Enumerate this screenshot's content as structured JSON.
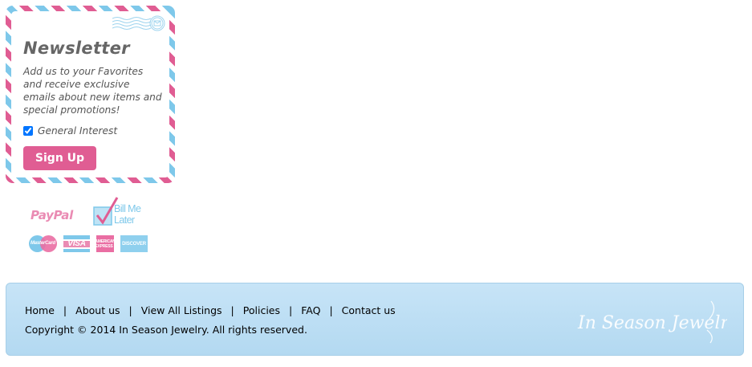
{
  "newsletter": {
    "title": "Newsletter",
    "description": "Add us to your Favorites and receive exclusive emails about new items and special promotions!",
    "checkbox_label": "General Interest",
    "checkbox_checked": true,
    "signup_label": "Sign Up"
  },
  "payments": {
    "paypal": "PayPal",
    "billme": [
      "Bill Me",
      "Later"
    ],
    "cards": {
      "mastercard": "MasterCard",
      "visa": "VISA",
      "amex": "AMERICAN EXPRESS",
      "discover": "DISCOVER"
    }
  },
  "footer": {
    "nav": [
      {
        "label": "Home"
      },
      {
        "label": "About us"
      },
      {
        "label": "View All Listings"
      },
      {
        "label": "Policies"
      },
      {
        "label": "FAQ"
      },
      {
        "label": "Contact us"
      }
    ],
    "separator": "|",
    "copyright": "Copyright © 2014 In Season Jewelry. All rights reserved.",
    "logo_text": "In Season Jewelry"
  },
  "colors": {
    "pink": "#e05d93",
    "light_blue": "#7ec8ea",
    "footer_bg": "#c7e4f7"
  }
}
